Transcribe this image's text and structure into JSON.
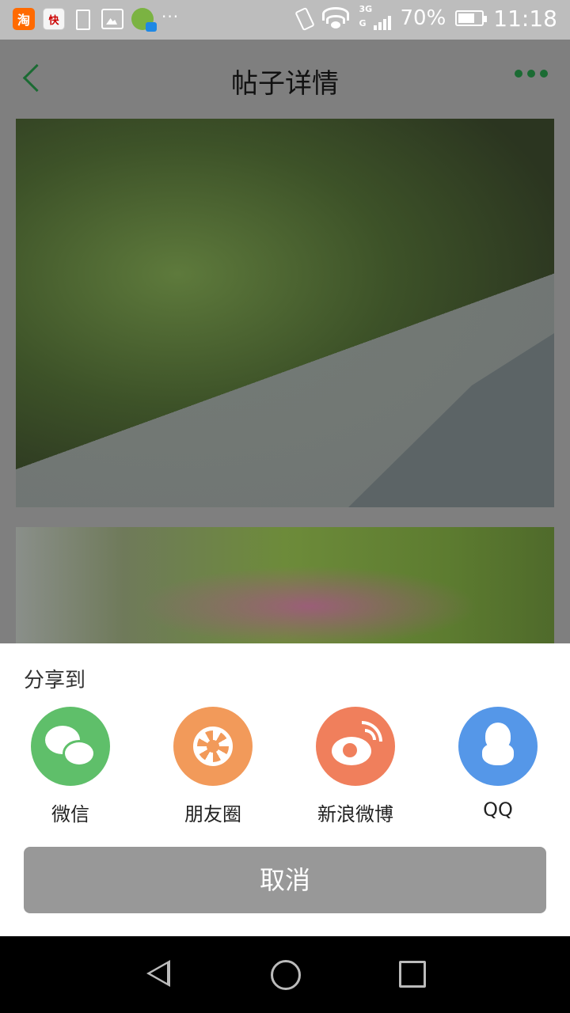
{
  "status_bar": {
    "app_icons": [
      "taobao-icon",
      "tabloid-icon",
      "battery-warning-icon",
      "gallery-icon",
      "game-icon"
    ],
    "overflow": "···",
    "network_top": "3G",
    "network_bottom": "G",
    "battery_percent": "70%",
    "battery_level": 0.7,
    "time": "11:18"
  },
  "header": {
    "title": "帖子详情",
    "accent_color": "#1b6b33"
  },
  "content": {
    "images": [
      "trees-path-photo",
      "blossom-trees-photo"
    ]
  },
  "share_sheet": {
    "title": "分享到",
    "options": [
      {
        "label": "微信",
        "icon": "wechat-icon",
        "color": "#5fbf6a"
      },
      {
        "label": "朋友圈",
        "icon": "moments-icon",
        "color": "#f29a5a"
      },
      {
        "label": "新浪微博",
        "icon": "weibo-icon",
        "color": "#f07f5c"
      },
      {
        "label": "QQ",
        "icon": "qq-icon",
        "color": "#5597e8"
      }
    ],
    "cancel_label": "取消"
  },
  "nav_bar": {
    "buttons": [
      "nav-back-icon",
      "nav-home-icon",
      "nav-recent-icon"
    ]
  }
}
